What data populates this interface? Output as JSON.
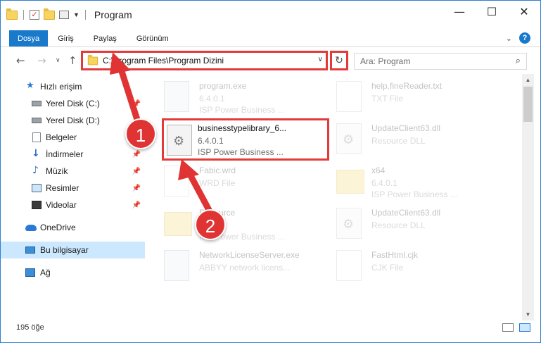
{
  "window": {
    "title": "Program",
    "controls": {
      "minimize": "—",
      "maximize": "☐",
      "close": "✕"
    }
  },
  "ribbon": {
    "tabs": [
      "Dosya",
      "Giriş",
      "Paylaş",
      "Görünüm"
    ],
    "help": "?"
  },
  "address": {
    "path": "C:\\Program Files\\Program Dizini",
    "search_placeholder": "Ara: Program"
  },
  "sidebar": {
    "items": [
      {
        "label": "Hızlı erişim",
        "icon": "star-icon",
        "pinned": false
      },
      {
        "label": "Yerel Disk (C:)",
        "icon": "drive-icon",
        "pinned": true
      },
      {
        "label": "Yerel Disk (D:)",
        "icon": "drive-icon",
        "pinned": true
      },
      {
        "label": "Belgeler",
        "icon": "documents-icon",
        "pinned": true
      },
      {
        "label": "İndirmeler",
        "icon": "downloads-icon",
        "pinned": true
      },
      {
        "label": "Müzik",
        "icon": "music-icon",
        "pinned": true
      },
      {
        "label": "Resimler",
        "icon": "pictures-icon",
        "pinned": true
      },
      {
        "label": "Videolar",
        "icon": "videos-icon",
        "pinned": true
      },
      {
        "label": "OneDrive",
        "icon": "onedrive-icon",
        "pinned": false
      },
      {
        "label": "Bu bilgisayar",
        "icon": "this-pc-icon",
        "pinned": false
      },
      {
        "label": "Ağ",
        "icon": "network-icon",
        "pinned": false
      }
    ],
    "pin_glyph": "📌"
  },
  "files": [
    {
      "name": "program.exe",
      "line2": "6.4.0.1",
      "line3": "ISP Power Business ...",
      "icon": "exe-icon"
    },
    {
      "name": "help.fineReader.txt",
      "line2": "TXT File",
      "line3": "",
      "icon": "text-file-icon"
    },
    {
      "name": "businesstypelibrary_6...",
      "line2": "6.4.0.1",
      "line3": "ISP Power Business ...",
      "icon": "dll-gear-icon"
    },
    {
      "name": "UpdateClient63.dll",
      "line2": "Resource DLL",
      "line3": "",
      "icon": "dll-gear-icon"
    },
    {
      "name": "Fabic.wrd",
      "line2": "WRD File",
      "line3": "",
      "icon": "file-icon"
    },
    {
      "name": "x64",
      "line2": "6.4.0.1",
      "line3": "ISP Power Business ...",
      "icon": "folder-icon"
    },
    {
      "name": "Resource",
      "line2": "",
      "line3": "ISP Power Business ...",
      "icon": "folder-icon"
    },
    {
      "name": "UpdateClient63.dll",
      "line2": "Resource DLL",
      "line3": "",
      "icon": "dll-gear-icon"
    },
    {
      "name": "NetworkLicenseServer.exe",
      "line2": "ABBYY network licens...",
      "line3": "",
      "icon": "exe-icon"
    },
    {
      "name": "FastHtml.cjk",
      "line2": "CJK File",
      "line3": "",
      "icon": "file-icon"
    }
  ],
  "status": {
    "count": "195 öğe"
  },
  "annotations": {
    "step1": "1",
    "step2": "2"
  },
  "colors": {
    "accent": "#1979ca",
    "highlight": "#e33a3a",
    "selected": "#cce8ff"
  }
}
